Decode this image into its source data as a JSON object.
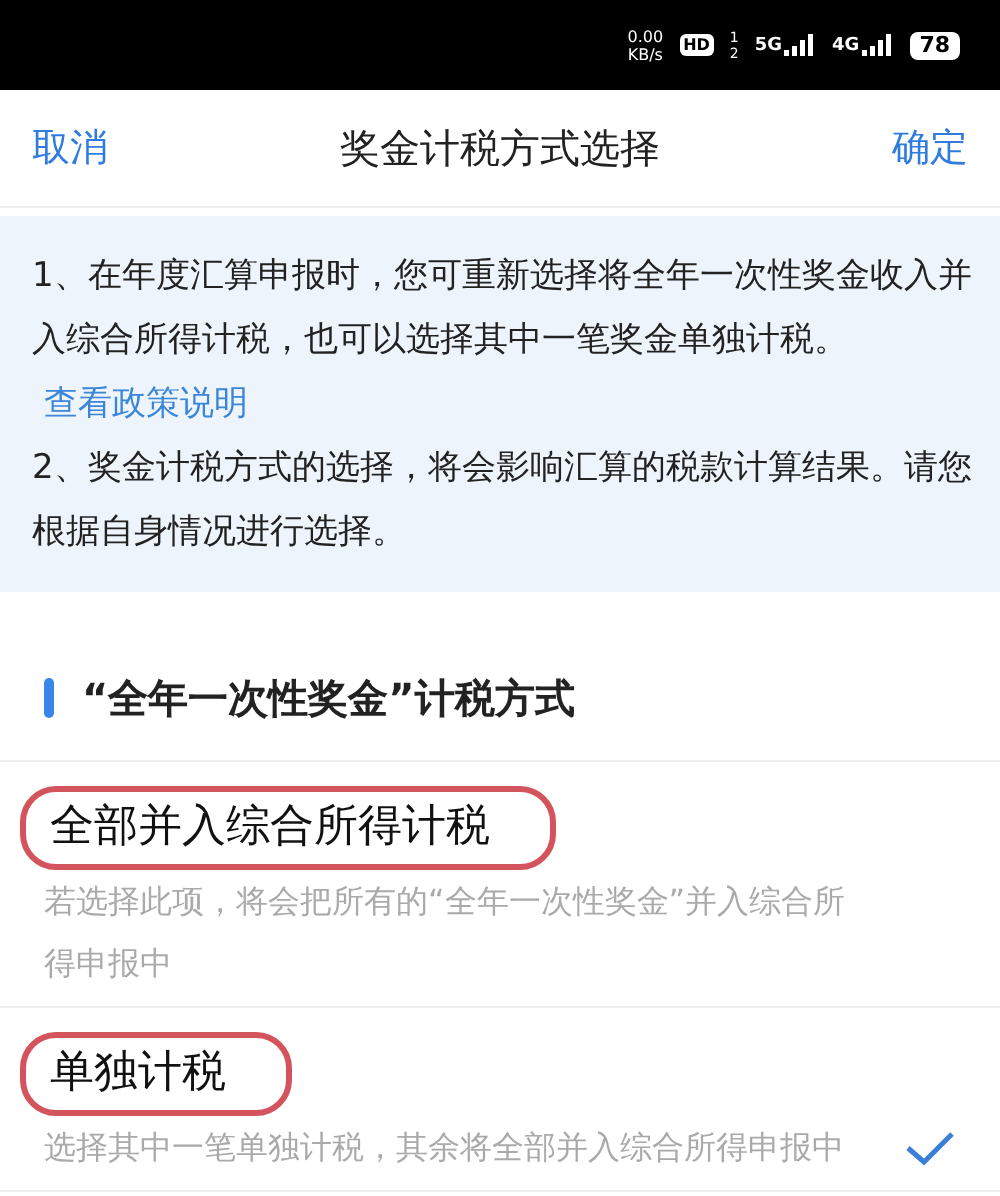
{
  "status_bar": {
    "speed": "0.00",
    "speed_unit": "KB/s",
    "hd": "HD",
    "sim_slots": [
      "1",
      "2"
    ],
    "networks": [
      "5G",
      "4G"
    ],
    "battery": "78"
  },
  "nav": {
    "cancel": "取消",
    "title": "奖金计税方式选择",
    "confirm": "确定"
  },
  "notice": {
    "paragraphs": [
      {
        "text": "1、在年度汇算申报时，您可重新选择将全年一次性奖金收入并入综合所得计税，也可以选择其中一笔奖金单独计税。",
        "link": "查看政策说明"
      },
      {
        "text": "2、奖金计税方式的选择，将会影响汇算的税款计算结果。请您根据自身情况进行选择。"
      }
    ]
  },
  "section": {
    "title": "“全年一次性奖金”计税方式"
  },
  "options": [
    {
      "title": "全部并入综合所得计税",
      "description": "若选择此项，将会把所有的“全年一次性奖金”并入综合所得申报中",
      "selected": false,
      "circled": true
    },
    {
      "title": "单独计税",
      "description": "选择其中一笔单独计税，其余将全部并入综合所得申报中",
      "selected": true,
      "circled": true
    }
  ]
}
